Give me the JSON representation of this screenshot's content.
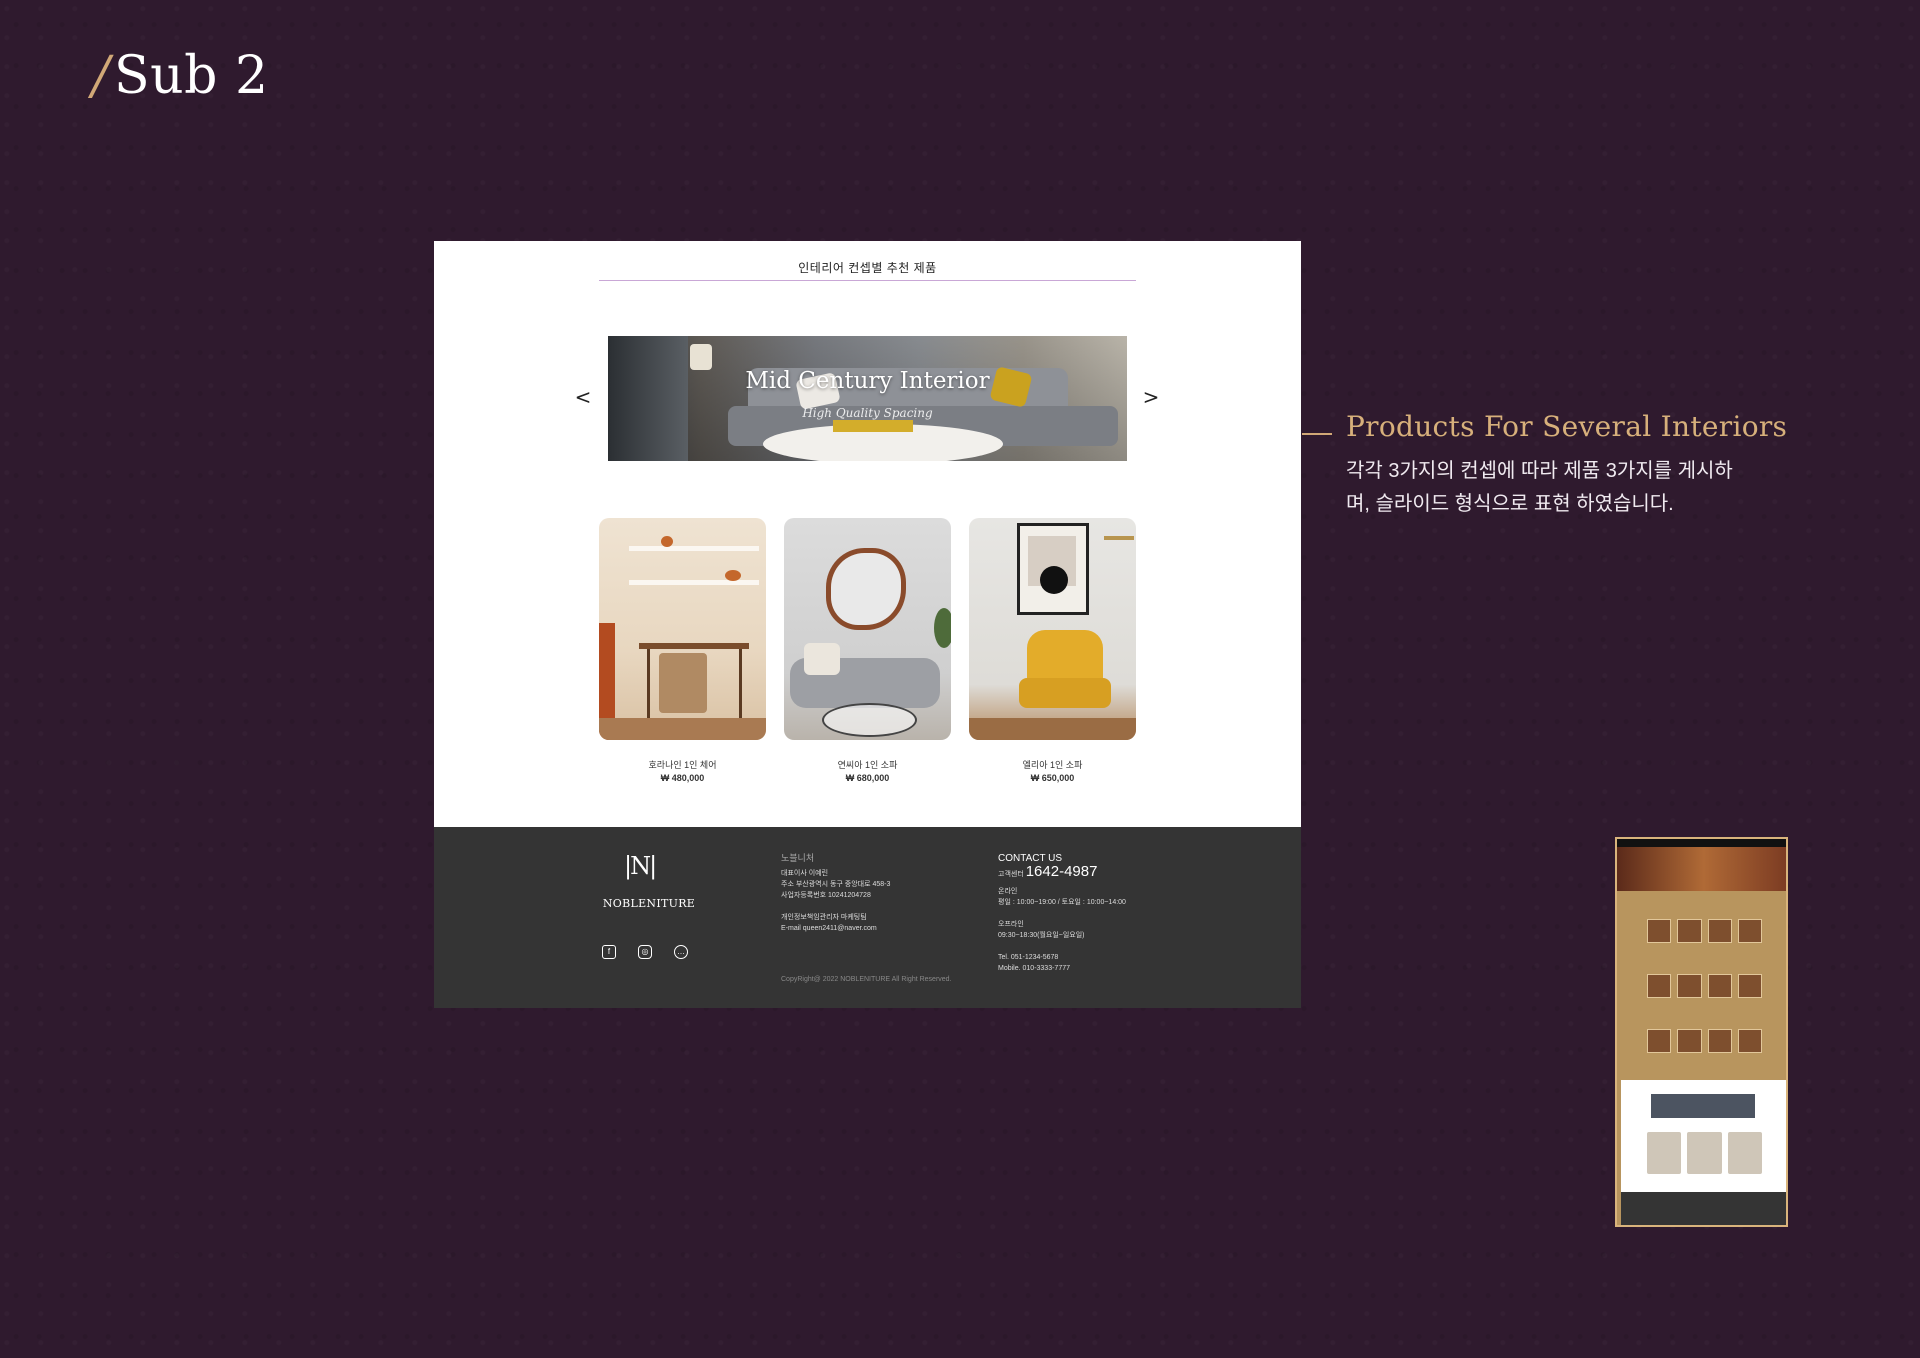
{
  "page": {
    "slash": "/",
    "title": "Sub 2"
  },
  "mock": {
    "section_title": "인테리어 컨셉별 추천 제품",
    "arrow_left": "<",
    "arrow_right": ">",
    "banner": {
      "title": "Mid Century Interior",
      "subtitle": "High Quality Spacing"
    },
    "products": [
      {
        "name": "호라나인 1인 체어",
        "price": "₩ 480,000"
      },
      {
        "name": "연씨아 1인 소파",
        "price": "₩ 680,000"
      },
      {
        "name": "엘리아 1인 소파",
        "price": "₩ 650,000"
      }
    ],
    "footer": {
      "logo_mark": "|N|",
      "logo_text": "NOBLENITURE",
      "brand_kr": "노블니처",
      "ceo": "대표이사 이예린",
      "address": "주소 부산광역시 동구 중앙대로 458-3",
      "biz_no": "사업자등록번호 10241204728",
      "privacy": "개인정보책임관리자 마케팅팀",
      "email": "E-mail queen2411@naver.com",
      "copyright": "CopyRight@ 2022 NOBLENITURE All Right Reserved.",
      "contact_title": "CONTACT US",
      "center_label": "고객센터",
      "center_phone": "1642-4987",
      "online_label": "온라인",
      "online_hours": "평일 : 10:00~19:00 / 토요일 : 10:00~14:00",
      "offline_label": "오프라인",
      "offline_hours": "09:30~18:30(월요일~일요일)",
      "tel": "Tel. 051-1234-5678",
      "mobile": "Mobile. 010-3333-7777"
    },
    "icons": [
      "facebook-icon",
      "instagram-icon",
      "chat-icon"
    ]
  },
  "callout": {
    "title": "Products For Several Interiors",
    "body": "각각 3가지의 컨셉에 따라 제품 3가지를 게시하며, 슬라이드 형식으로 표현 하였습니다."
  },
  "colors": {
    "background": "#2f1a2e",
    "accent_gold": "#d7b07b",
    "footer_dark": "#343434"
  }
}
